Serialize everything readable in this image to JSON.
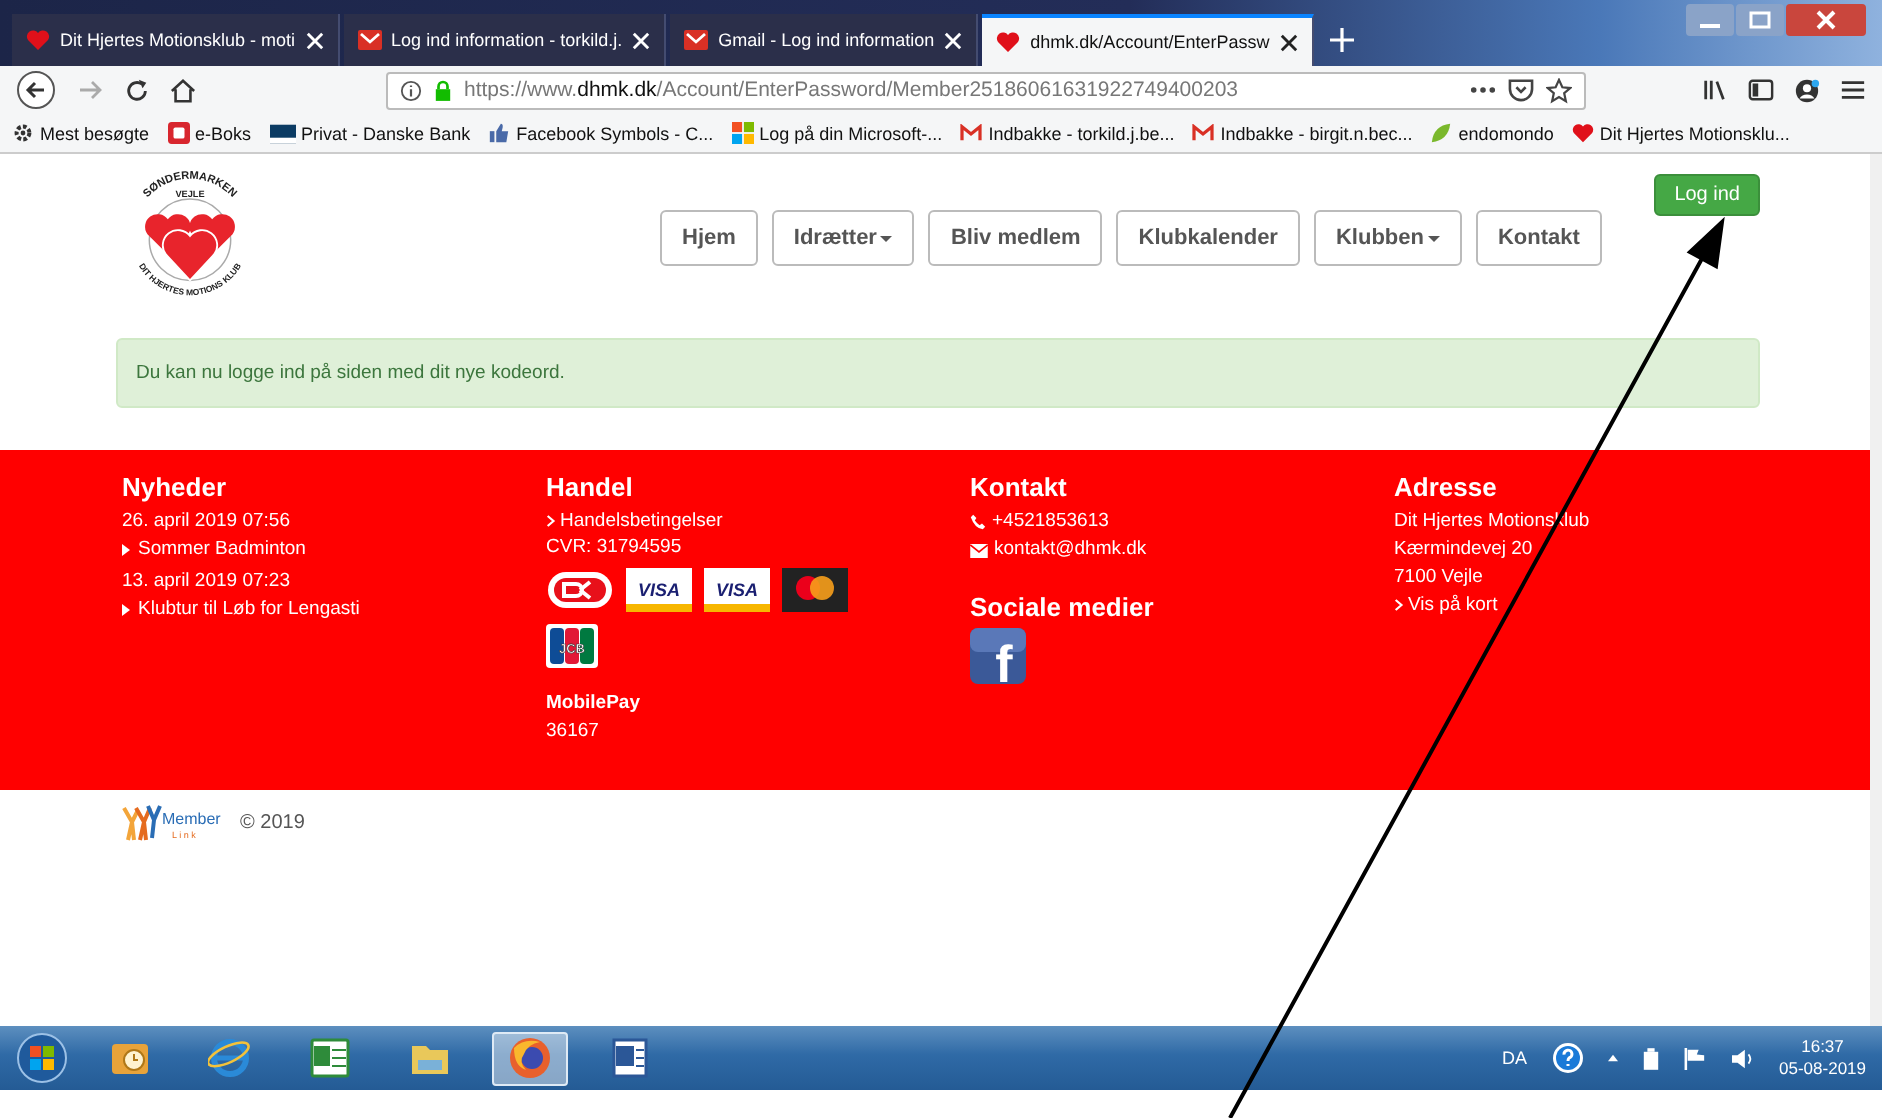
{
  "browser": {
    "tabs": [
      {
        "label": "Dit Hjertes Motionsklub - moti",
        "kind": "heart",
        "selected": false
      },
      {
        "label": "Log ind information - torkild.j.",
        "kind": "mail",
        "selected": false
      },
      {
        "label": "Gmail - Log ind information",
        "kind": "mail",
        "selected": false
      },
      {
        "label": "dhmk.dk/Account/EnterPassw",
        "kind": "heart",
        "selected": true
      }
    ],
    "address": {
      "prefix": "https://www.",
      "domain": "dhmk.dk",
      "path": "/Account/EnterPassword/Member25186061631922749400203"
    },
    "bookmarks": [
      {
        "label": "Mest besøgte",
        "kind": "gear"
      },
      {
        "label": "e-Boks",
        "kind": "eboks"
      },
      {
        "label": "Privat - Danske Bank",
        "kind": "bank"
      },
      {
        "label": "Facebook Symbols - C...",
        "kind": "thumb"
      },
      {
        "label": "Log på din Microsoft-...",
        "kind": "windows"
      },
      {
        "label": "Indbakke - torkild.j.be...",
        "kind": "gmail"
      },
      {
        "label": "Indbakke - birgit.n.bec...",
        "kind": "gmail"
      },
      {
        "label": "endomondo",
        "kind": "leaf"
      },
      {
        "label": "Dit Hjertes Motionsklu...",
        "kind": "heart"
      }
    ]
  },
  "site": {
    "logo": {
      "top_text": "SØNDERMARKEN",
      "mid_text": "VEJLE",
      "bottom_text": "DIT HJERTES MOTIONS KLUB"
    },
    "nav": [
      {
        "label": "Hjem",
        "dropdown": false
      },
      {
        "label": "Idrætter",
        "dropdown": true
      },
      {
        "label": "Bliv medlem",
        "dropdown": false
      },
      {
        "label": "Klubkalender",
        "dropdown": false
      },
      {
        "label": "Klubben",
        "dropdown": true
      },
      {
        "label": "Kontakt",
        "dropdown": false
      }
    ],
    "login_button": "Log ind",
    "alert": "Du kan nu logge ind på siden med dit nye kodeord.",
    "footer": {
      "news": {
        "title": "Nyheder",
        "items": [
          {
            "date": "26. april 2019 07:56",
            "title": "Sommer Badminton"
          },
          {
            "date": "13. april 2019 07:23",
            "title": "Klubtur til Løb for Lengasti"
          }
        ]
      },
      "trade": {
        "title": "Handel",
        "link": "Handelsbetingelser",
        "cvr": "CVR: 31794595",
        "cards": [
          {
            "kind": "dankort"
          },
          {
            "kind": "visa",
            "label": "VISA"
          },
          {
            "kind": "visa",
            "label": "VISA"
          },
          {
            "kind": "mastercard"
          },
          {
            "kind": "jcb",
            "label": "JCB"
          }
        ],
        "mobilepay_title": "MobilePay",
        "mobilepay_number": "36167"
      },
      "contact": {
        "title": "Kontakt",
        "phone": "+4521853613",
        "email": "kontakt@dhmk.dk",
        "social_title": "Sociale medier",
        "social": [
          {
            "kind": "facebook",
            "label": "f"
          }
        ]
      },
      "address": {
        "title": "Adresse",
        "lines": [
          "Dit Hjertes Motionsklub",
          "Kærmindevej 20",
          "7100 Vejle"
        ],
        "map_link": "Vis på kort"
      }
    },
    "credit": {
      "logo_text": "Member",
      "logo_subtext": "L i n k",
      "copyright": "© 2019"
    }
  },
  "taskbar": {
    "apps": [
      {
        "kind": "outlook",
        "selected": false
      },
      {
        "kind": "ie",
        "selected": false
      },
      {
        "kind": "excel",
        "selected": false
      },
      {
        "kind": "explorer",
        "selected": false
      },
      {
        "kind": "firefox",
        "selected": true
      },
      {
        "kind": "word",
        "selected": false
      }
    ],
    "language": "DA",
    "time": "16:37",
    "date": "05-08-2019"
  }
}
